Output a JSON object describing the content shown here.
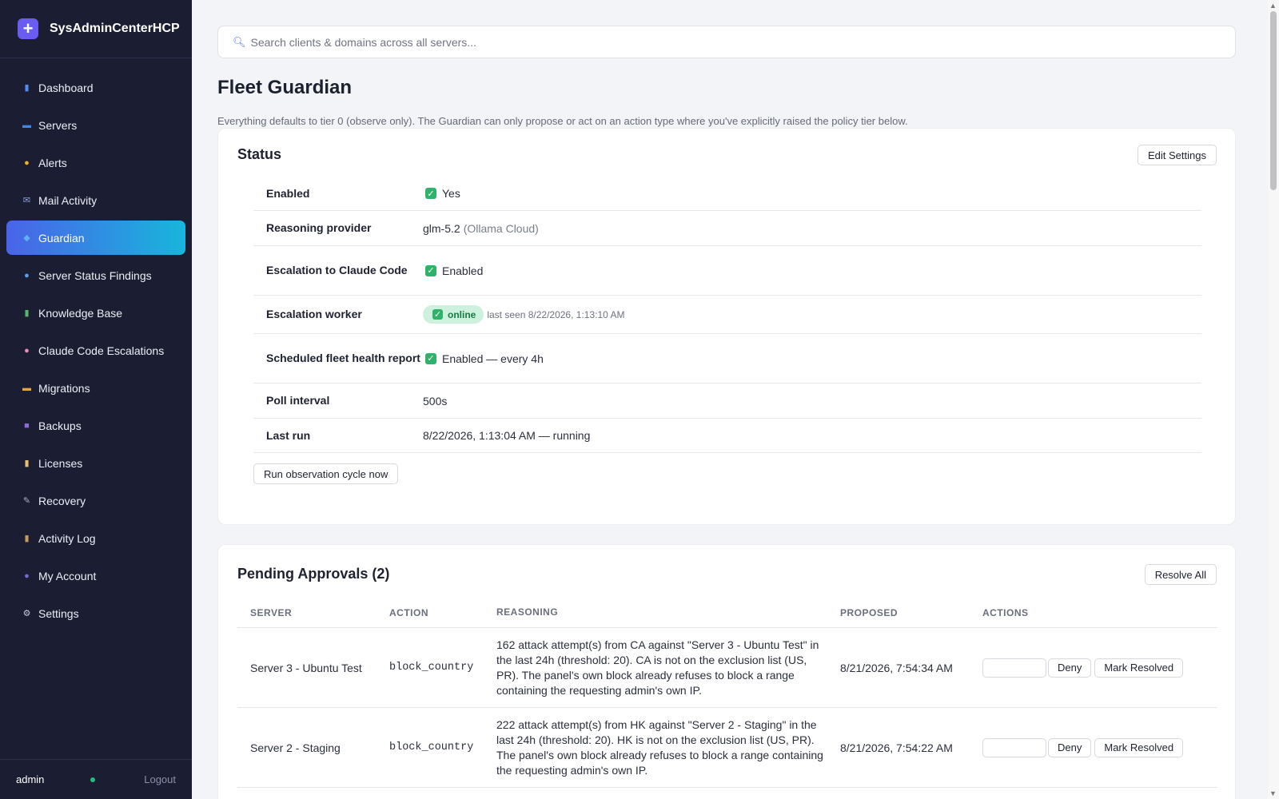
{
  "app": {
    "name": "SysAdminCenterHCP",
    "logo_glyph": "+"
  },
  "sidebar": {
    "items": [
      {
        "label": "Dashboard",
        "icon": "bar-chart-icon",
        "glyph": "▮",
        "color": "#4d8ef0",
        "active": false
      },
      {
        "label": "Servers",
        "icon": "monitor-icon",
        "glyph": "▬",
        "color": "#3f86e6",
        "active": false
      },
      {
        "label": "Alerts",
        "icon": "bell-icon",
        "glyph": "●",
        "color": "#f2b21b",
        "active": false
      },
      {
        "label": "Mail Activity",
        "icon": "mail-icon",
        "glyph": "✉",
        "color": "#8aa4d6",
        "active": false
      },
      {
        "label": "Guardian",
        "icon": "shield-icon",
        "glyph": "◆",
        "color": "#5fb0f5",
        "active": true
      },
      {
        "label": "Server Status Findings",
        "icon": "magnifier-icon",
        "glyph": "●",
        "color": "#5aa0e8",
        "active": false
      },
      {
        "label": "Knowledge Base",
        "icon": "books-icon",
        "glyph": "▮",
        "color": "#5ab56b",
        "active": false
      },
      {
        "label": "Claude Code Escalations",
        "icon": "brain-icon",
        "glyph": "●",
        "color": "#f08cb8",
        "active": false
      },
      {
        "label": "Migrations",
        "icon": "truck-icon",
        "glyph": "▬",
        "color": "#e8a53a",
        "active": false
      },
      {
        "label": "Backups",
        "icon": "floppy-disk-icon",
        "glyph": "■",
        "color": "#8c6ad8",
        "active": false
      },
      {
        "label": "Licenses",
        "icon": "scroll-icon",
        "glyph": "▮",
        "color": "#e6c070",
        "active": false
      },
      {
        "label": "Recovery",
        "icon": "wrench-icon",
        "glyph": "✎",
        "color": "#a8b4c8",
        "active": false
      },
      {
        "label": "Activity Log",
        "icon": "clipboard-icon",
        "glyph": "▮",
        "color": "#c89a5c",
        "active": false
      },
      {
        "label": "My Account",
        "icon": "user-icon",
        "glyph": "●",
        "color": "#7a6ad0",
        "active": false
      },
      {
        "label": "Settings",
        "icon": "gear-icon",
        "glyph": "⚙",
        "color": "#c8ccd8",
        "active": false
      }
    ],
    "footer": {
      "user": "admin",
      "logout": "Logout"
    }
  },
  "search": {
    "placeholder": "Search clients & domains across all servers..."
  },
  "page": {
    "title": "Fleet Guardian",
    "subtitle": "Everything defaults to tier 0 (observe only). The Guardian can only propose or act on an action type where you've explicitly raised the policy tier below."
  },
  "status": {
    "title": "Status",
    "edit_button": "Edit Settings",
    "run_button": "Run observation cycle now",
    "rows": {
      "enabled": {
        "key": "Enabled",
        "value": "Yes"
      },
      "provider": {
        "key": "Reasoning provider",
        "value": "glm-5.2",
        "extra": "(Ollama Cloud)"
      },
      "escalation": {
        "key": "Escalation to Claude Code",
        "value": "Enabled"
      },
      "worker": {
        "key": "Escalation worker",
        "badge": "online",
        "last_seen": "last seen 8/22/2026, 1:13:10 AM"
      },
      "report": {
        "key": "Scheduled fleet health report",
        "value": "Enabled — every 4h"
      },
      "poll": {
        "key": "Poll interval",
        "value": "500s"
      },
      "last_run": {
        "key": "Last run",
        "value": "8/22/2026, 1:13:04 AM — running"
      }
    }
  },
  "pending": {
    "title": "Pending Approvals (2)",
    "resolve_all": "Resolve All",
    "columns": [
      "SERVER",
      "ACTION",
      "REASONING",
      "PROPOSED",
      "ACTIONS"
    ],
    "deny_label": "Deny",
    "resolve_label": "Mark Resolved",
    "rows": [
      {
        "server": "Server 3 - Ubuntu Test",
        "action": "block_country",
        "reasoning": "162 attack attempt(s) from CA against \"Server 3 - Ubuntu Test\" in the last 24h (threshold: 20). CA is not on the exclusion list (US, PR). The panel's own block already refuses to block a range containing the requesting admin's own IP.",
        "proposed": "8/21/2026, 7:54:34 AM"
      },
      {
        "server": "Server 2 - Staging",
        "action": "block_country",
        "reasoning": "222 attack attempt(s) from HK against \"Server 2 - Staging\" in the last 24h (threshold: 20). HK is not on the exclusion list (US, PR). The panel's own block already refuses to block a range containing the requesting admin's own IP.",
        "proposed": "8/21/2026, 7:54:22 AM"
      }
    ]
  },
  "colors": {
    "sidebar_bg": "#1b1d33",
    "active_start": "#4a63e8",
    "active_end": "#17b6dc",
    "success": "#2fb36a"
  }
}
